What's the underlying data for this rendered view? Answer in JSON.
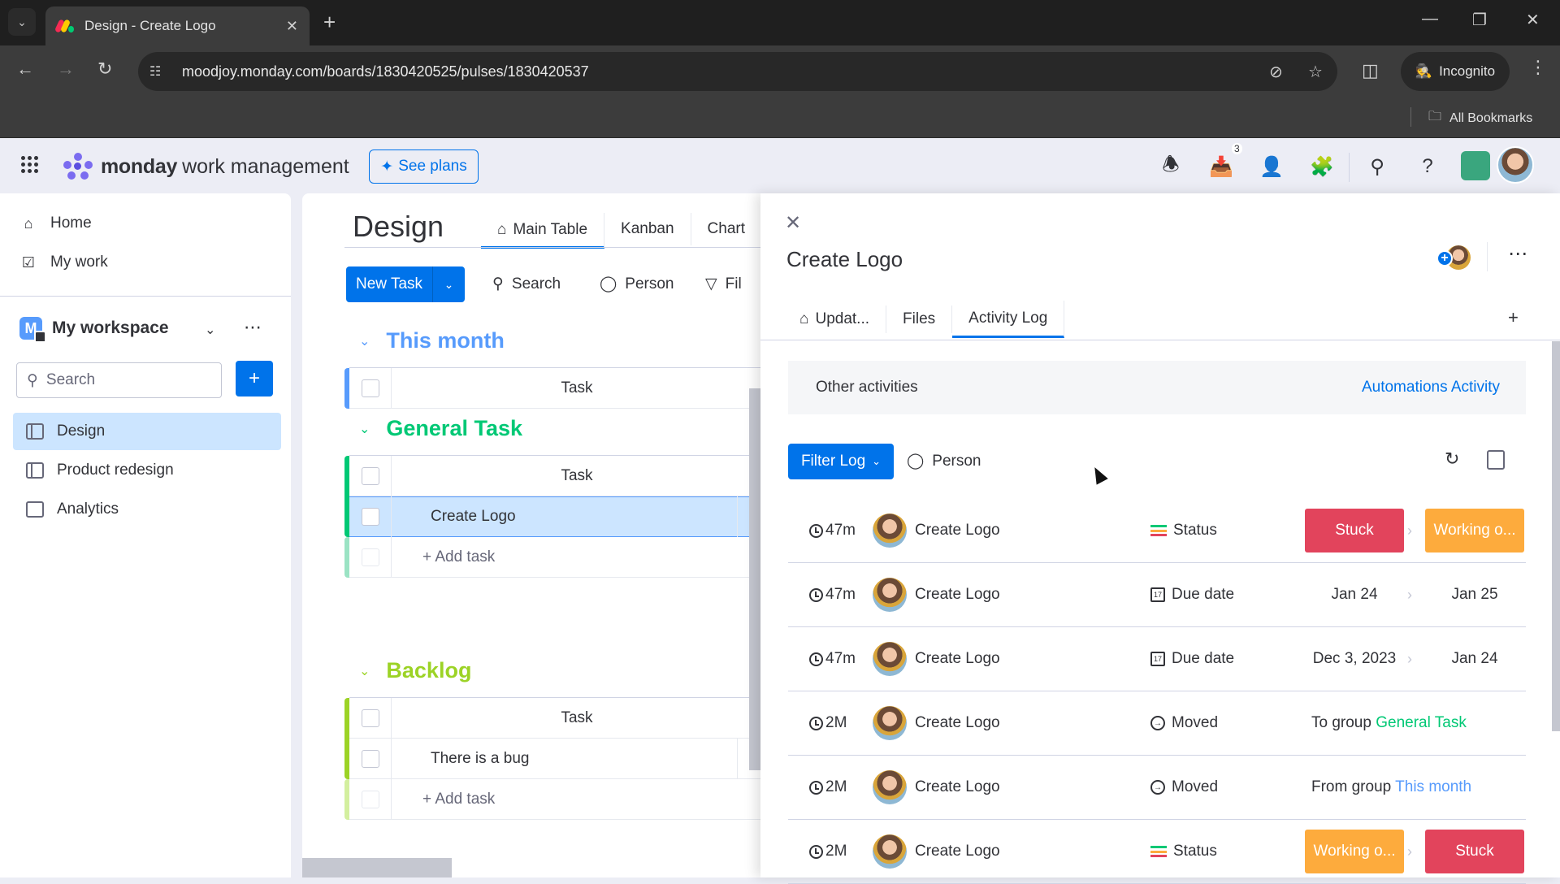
{
  "browser": {
    "tab_title": "Design - Create Logo",
    "url": "moodjoy.monday.com/boards/1830420525/pulses/1830420537",
    "incognito_label": "Incognito",
    "bookmarks_label": "All Bookmarks"
  },
  "app_header": {
    "brand": "monday",
    "brand_sub": "work management",
    "see_plans": "See plans",
    "inbox_badge": "3"
  },
  "sidebar": {
    "home": "Home",
    "my_work": "My work",
    "workspace_initial": "M",
    "workspace_name": "My workspace",
    "search_placeholder": "Search",
    "boards": [
      {
        "label": "Design",
        "selected": true
      },
      {
        "label": "Product redesign",
        "selected": false
      },
      {
        "label": "Analytics",
        "selected": false
      }
    ]
  },
  "board": {
    "title": "Design",
    "views": [
      "Main Table",
      "Kanban",
      "Chart"
    ],
    "toolbar": {
      "new_task": "New Task",
      "search": "Search",
      "person": "Person",
      "filter": "Fil"
    },
    "groups": [
      {
        "name": "This month",
        "color": "#579bfc",
        "column_header": "Task",
        "items": [],
        "add_label": null
      },
      {
        "name": "General Task",
        "color": "#00c875",
        "column_header": "Task",
        "items": [
          "Create Logo"
        ],
        "add_label": "+ Add task"
      },
      {
        "name": "Backlog",
        "color": "#9cd326",
        "column_header": "Task",
        "items": [
          "There is a bug"
        ],
        "add_label": "+ Add task"
      }
    ]
  },
  "panel": {
    "item_title": "Create Logo",
    "tabs": [
      "Updat...",
      "Files",
      "Activity Log"
    ],
    "active_tab": "Activity Log",
    "other_activities": "Other activities",
    "automations_activity": "Automations Activity",
    "filter_log": "Filter Log",
    "person_filter": "Person",
    "log": [
      {
        "time": "47m",
        "item": "Create Logo",
        "column": "Status",
        "column_icon": "status-icon",
        "type": "status",
        "from": "Stuck",
        "from_color": "#e2445c",
        "to": "Working o...",
        "to_color": "#fdab3d"
      },
      {
        "time": "47m",
        "item": "Create Logo",
        "column": "Due date",
        "column_icon": "calendar-icon",
        "type": "date",
        "from": "Jan 24",
        "to": "Jan 25"
      },
      {
        "time": "47m",
        "item": "Create Logo",
        "column": "Due date",
        "column_icon": "calendar-icon",
        "type": "date",
        "from": "Dec 3, 2023",
        "to": "Jan 24"
      },
      {
        "time": "2M",
        "item": "Create Logo",
        "column": "Moved",
        "column_icon": "move-icon",
        "type": "group",
        "prefix": "To group",
        "group": "General Task",
        "group_color": "#00c875"
      },
      {
        "time": "2M",
        "item": "Create Logo",
        "column": "Moved",
        "column_icon": "move-icon",
        "type": "group",
        "prefix": "From group",
        "group": "This month",
        "group_color": "#579bfc"
      },
      {
        "time": "2M",
        "item": "Create Logo",
        "column": "Status",
        "column_icon": "status-icon",
        "type": "status",
        "from": "Working o...",
        "from_color": "#fdab3d",
        "to": "Stuck",
        "to_color": "#e2445c"
      }
    ]
  }
}
